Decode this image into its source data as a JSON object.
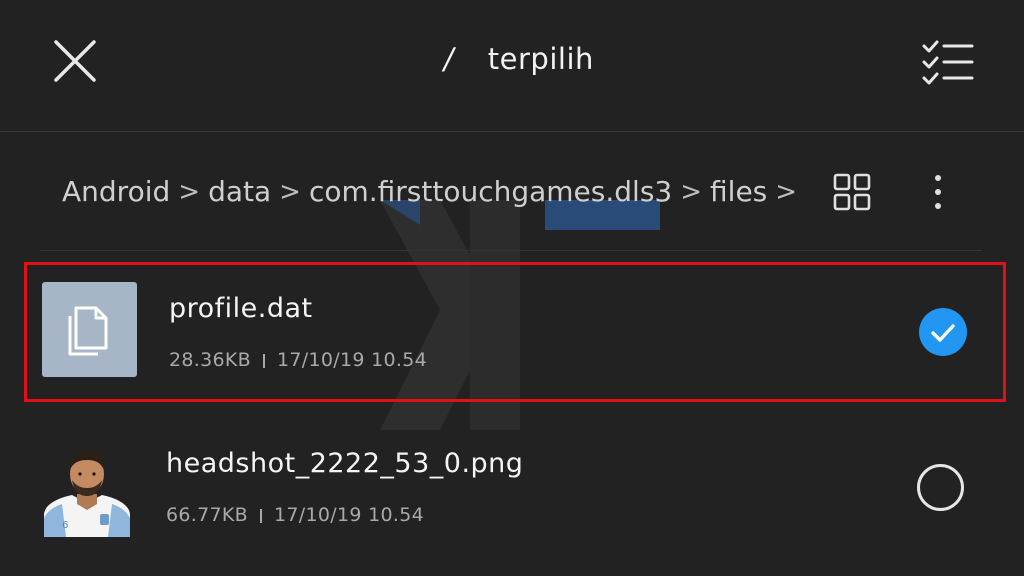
{
  "header": {
    "selected_count": "",
    "separator": "/",
    "selected_label": "terpilih",
    "close_icon": "close-icon",
    "select_all_icon": "checklist-icon"
  },
  "breadcrumb": {
    "items": [
      "Android",
      "data",
      "com.firsttouchgames.dls3",
      "files"
    ],
    "separator": ">",
    "grid_icon": "grid-view-icon",
    "more_icon": "more-vertical-icon"
  },
  "files": [
    {
      "name": "profile.dat",
      "size": "28.36KB",
      "date": "17/10/19 10.54",
      "selected": true,
      "icon": "document-copy-icon"
    },
    {
      "name": "headshot_2222_53_0.png",
      "size": "66.77KB",
      "date": "17/10/19 10.54",
      "selected": false,
      "icon": "player-headshot-thumbnail"
    }
  ],
  "colors": {
    "background": "#222222",
    "highlight_border": "#e01218",
    "check_blue": "#2196f3",
    "thumb_bg": "#a7b6c6",
    "watermark": "#2a4a78"
  }
}
